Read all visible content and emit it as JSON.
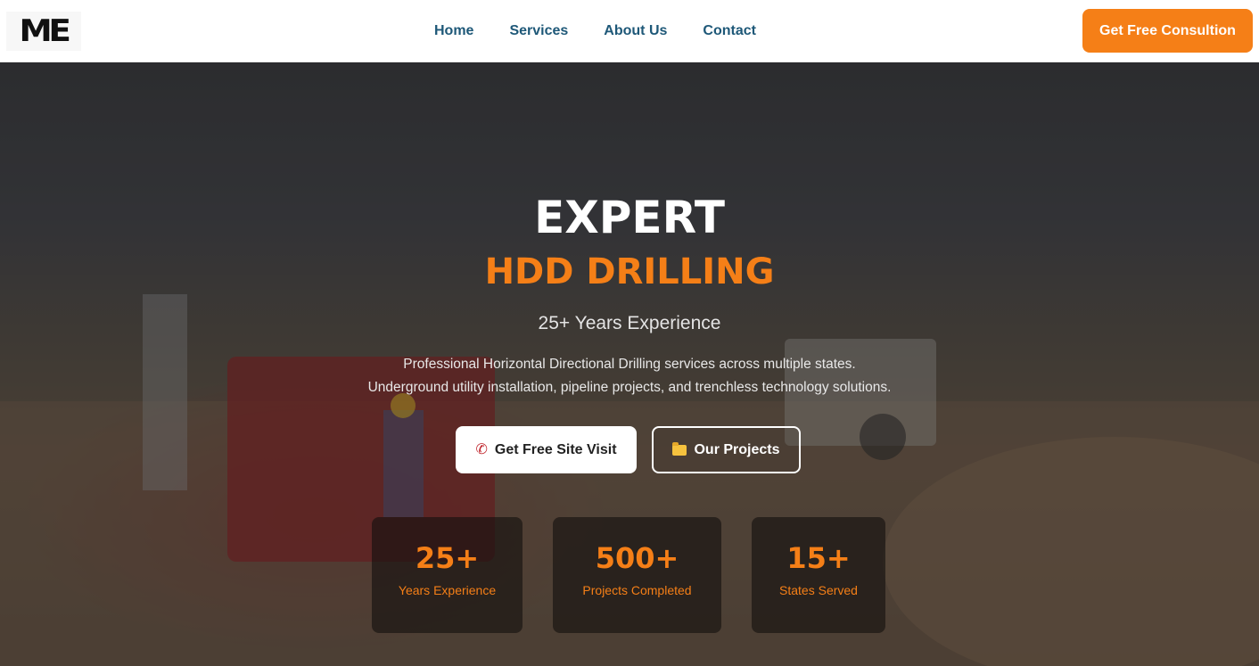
{
  "brand": {
    "logo_text": "ME"
  },
  "nav": {
    "items": [
      {
        "label": "Home"
      },
      {
        "label": "Services"
      },
      {
        "label": "About Us"
      },
      {
        "label": "Contact"
      }
    ],
    "cta_label": "Get Free Consultion"
  },
  "hero": {
    "title": "EXPERT",
    "subtitle": "HDD DRILLING",
    "tagline": "25+ Years Experience",
    "description_line1": "Professional Horizontal Directional Drilling services across multiple states.",
    "description_line2": "Underground utility installation, pipeline projects, and trenchless technology solutions.",
    "primary_button": {
      "label": "Get Free Site Visit",
      "icon": "phone-icon"
    },
    "secondary_button": {
      "label": "Our Projects",
      "icon": "folder-icon"
    }
  },
  "stats": [
    {
      "value": "25+",
      "label": "Years Experience"
    },
    {
      "value": "500+",
      "label": "Projects Completed"
    },
    {
      "value": "15+",
      "label": "States Served"
    }
  ],
  "colors": {
    "accent": "#f57f17",
    "nav_text": "#1e5878",
    "white": "#ffffff"
  }
}
